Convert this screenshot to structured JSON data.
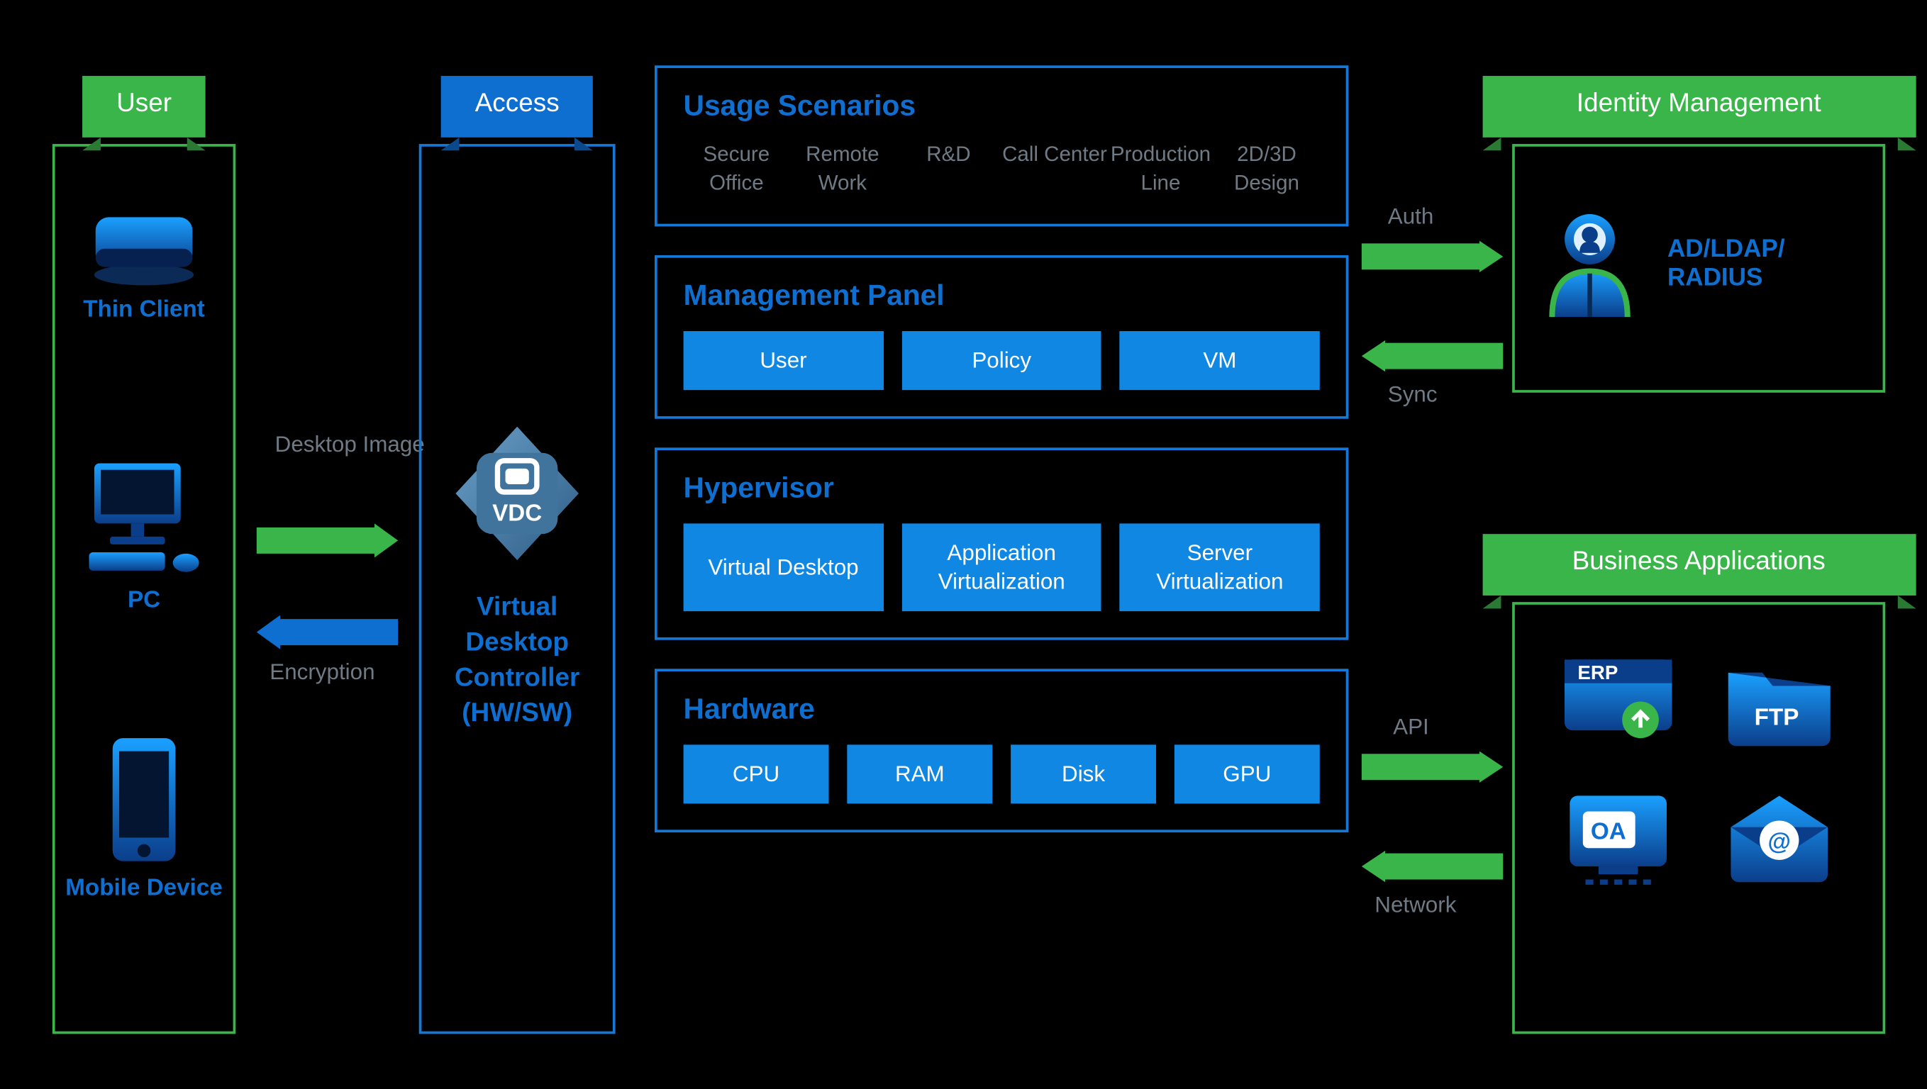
{
  "columns": {
    "user": {
      "title": "User"
    },
    "access": {
      "title": "Access"
    },
    "idm": {
      "title": "Identity Management"
    },
    "biz": {
      "title": "Business Applications"
    }
  },
  "userDevices": {
    "thinClient": "Thin Client",
    "pc": "PC",
    "mobile": "Mobile Device"
  },
  "userAccessArrows": {
    "toAccess": "Desktop Image",
    "fromAccess": "Encryption"
  },
  "access": {
    "iconText": "VDC",
    "label": "Virtual Desktop Controller (HW/SW)"
  },
  "panels": {
    "usage": {
      "title": "Usage Scenarios",
      "items": [
        "Secure Office",
        "Remote Work",
        "R&D",
        "Call Center",
        "Production Line",
        "2D/3D Design"
      ]
    },
    "mgmt": {
      "title": "Management Panel",
      "items": [
        "User",
        "Policy",
        "VM"
      ]
    },
    "hyp": {
      "title": "Hypervisor",
      "items": [
        "Virtual Desktop",
        "Application Virtualization",
        "Server Virtualization"
      ]
    },
    "hw": {
      "title": "Hardware",
      "items": [
        "CPU",
        "RAM",
        "Disk",
        "GPU"
      ]
    }
  },
  "rightArrows": {
    "auth": "Auth",
    "sync": "Sync",
    "api": "API",
    "network": "Network"
  },
  "idm": {
    "label": "AD/LDAP/ RADIUS"
  },
  "bizApps": {
    "erp": "ERP",
    "ftp": "FTP",
    "oa": "OA",
    "mail": "@"
  }
}
